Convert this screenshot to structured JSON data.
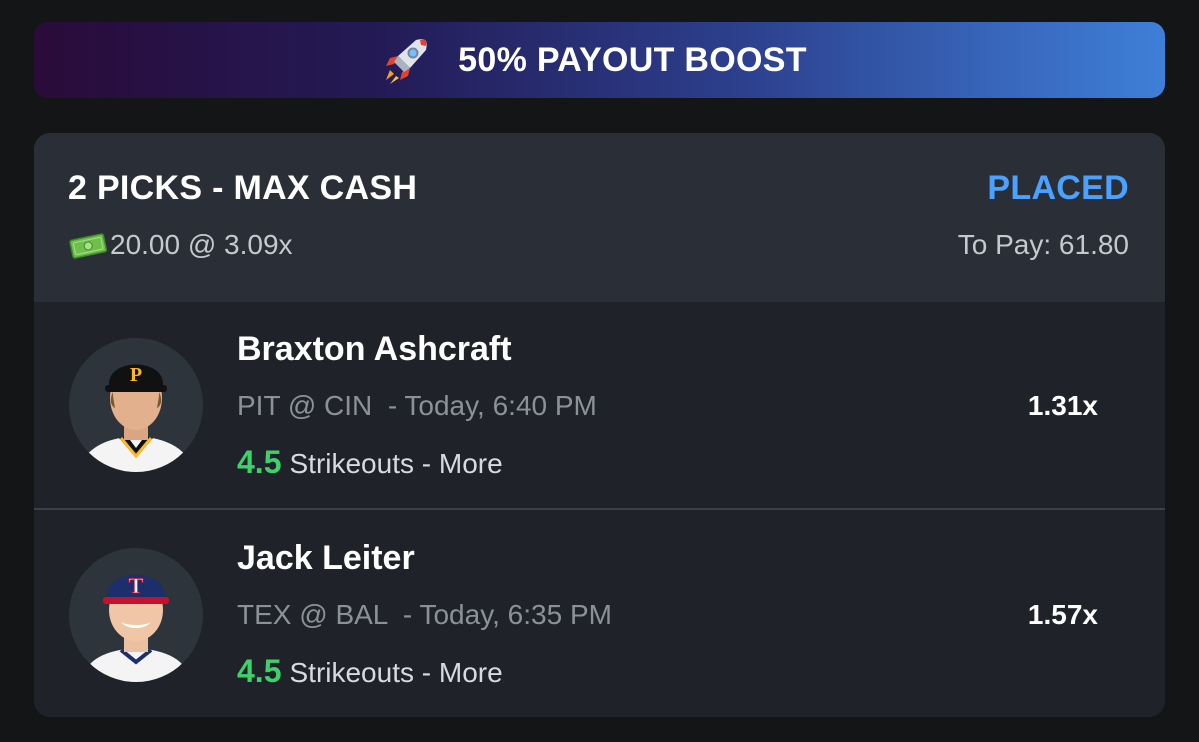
{
  "banner": {
    "icon": "rocket-icon",
    "text": "50% PAYOUT BOOST"
  },
  "entry": {
    "title": "2 PICKS - MAX CASH",
    "status": "PLACED",
    "stake_icon": "money-icon",
    "stake": "20.00 @ 3.09x",
    "to_pay": "To Pay: 61.80"
  },
  "picks": [
    {
      "player": "Braxton Ashcraft",
      "game": "PIT @ CIN  - Today, 6:40 PM",
      "line_value": "4.5",
      "line_text": "Strikeouts - More",
      "multiplier": "1.31x",
      "cap_color": "#111111",
      "cap_logo_color": "#fdb827"
    },
    {
      "player": "Jack Leiter",
      "game": "TEX @ BAL  - Today, 6:35 PM",
      "line_value": "4.5",
      "line_text": "Strikeouts - More",
      "multiplier": "1.57x",
      "cap_color": "#1c2e6b",
      "cap_logo_color": "#ffffff"
    }
  ],
  "colors": {
    "accent": "#4aa1ff",
    "line_value": "#3ed16a"
  }
}
